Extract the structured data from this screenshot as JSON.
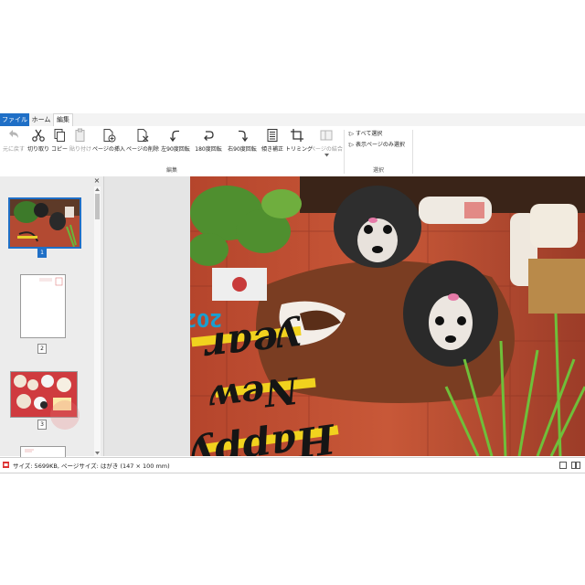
{
  "tabs": {
    "file": "ファイル",
    "home": "ホーム",
    "edit": "編集"
  },
  "ribbon": {
    "buttons": [
      {
        "label": "元に戻す",
        "icon": "undo-icon",
        "enabled": false
      },
      {
        "label": "切り取り",
        "icon": "scissors-icon",
        "enabled": true
      },
      {
        "label": "コピー",
        "icon": "copy-icon",
        "enabled": true
      },
      {
        "label": "貼り付け",
        "icon": "paste-icon",
        "enabled": false
      },
      {
        "label": "ページの挿入",
        "icon": "insert-page-icon",
        "enabled": true
      },
      {
        "label": "ページの削除",
        "icon": "delete-page-icon",
        "enabled": true
      },
      {
        "label": "左90度回転",
        "icon": "rotate-left-icon",
        "enabled": true
      },
      {
        "label": "180度回転",
        "icon": "rotate-180-icon",
        "enabled": true
      },
      {
        "label": "右90度回転",
        "icon": "rotate-right-icon",
        "enabled": true
      },
      {
        "label": "傾き補正",
        "icon": "deskew-icon",
        "enabled": true
      },
      {
        "label": "トリミング",
        "icon": "crop-icon",
        "enabled": true
      },
      {
        "label": "ページの結合",
        "icon": "merge-pages-icon",
        "enabled": false
      }
    ],
    "edit_group_label": "編集",
    "select_group_label": "選択",
    "select_all": "すべて選択",
    "select_visible": "表示ページのみ選択"
  },
  "thumbnails": {
    "close": "×",
    "pages": [
      "1",
      "2",
      "3"
    ]
  },
  "photo": {
    "year": "2021",
    "line1": "Happy",
    "line2": "New",
    "line3": "year"
  },
  "status": {
    "text": "サイズ: 5699KB, ページサイズ: はがき (147 × 100 mm)"
  },
  "colors": {
    "accent": "#1f6fc6"
  }
}
